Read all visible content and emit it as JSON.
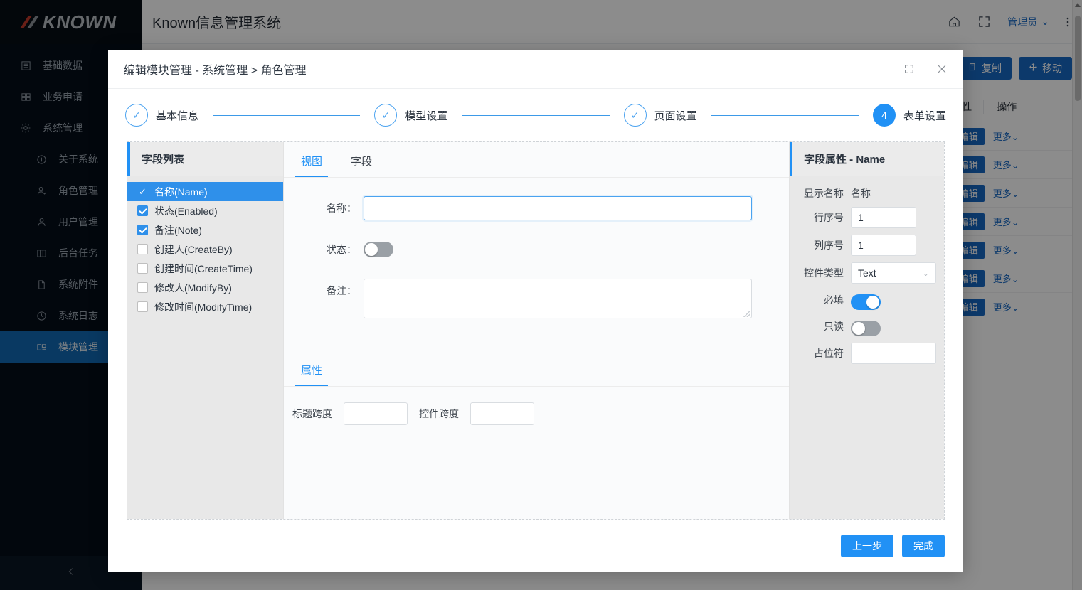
{
  "brand": {
    "logo_text": "KNOWN",
    "accent": "#c0392b"
  },
  "topbar": {
    "title": "Known信息管理系统",
    "home_icon": "home-icon",
    "fullscreen_icon": "fullscreen-icon",
    "user": "管理员",
    "user_caret": "⌄",
    "more_icon": "vertical-dots-icon"
  },
  "sidebar": {
    "items": [
      {
        "label": "基础数据",
        "icon": "list-icon",
        "level": 0,
        "active": false
      },
      {
        "label": "业务申请",
        "icon": "apps-icon",
        "level": 0,
        "active": false
      },
      {
        "label": "系统管理",
        "icon": "gear-icon",
        "level": 0,
        "active": false
      },
      {
        "label": "关于系统",
        "icon": "info-icon",
        "level": 1,
        "active": false
      },
      {
        "label": "角色管理",
        "icon": "role-icon",
        "level": 1,
        "active": false
      },
      {
        "label": "用户管理",
        "icon": "user-icon",
        "level": 1,
        "active": false
      },
      {
        "label": "后台任务",
        "icon": "task-icon",
        "level": 1,
        "active": false
      },
      {
        "label": "系统附件",
        "icon": "file-icon",
        "level": 1,
        "active": false
      },
      {
        "label": "系统日志",
        "icon": "clock-icon",
        "level": 1,
        "active": false
      },
      {
        "label": "模块管理",
        "icon": "module-icon",
        "level": 1,
        "active": true
      }
    ],
    "collapse_icon": "chevron-left-icon"
  },
  "background_page": {
    "toolbar": [
      {
        "label": "复制",
        "icon": "copy-icon"
      },
      {
        "label": "移动",
        "icon": "move-icon"
      }
    ],
    "columns": [
      "性",
      "操作"
    ],
    "rows": [
      {
        "edit": "编辑",
        "more": "更多"
      },
      {
        "edit": "编辑",
        "more": "更多"
      },
      {
        "edit": "编辑",
        "more": "更多"
      },
      {
        "edit": "编辑",
        "more": "更多"
      },
      {
        "edit": "编辑",
        "more": "更多"
      },
      {
        "edit": "编辑",
        "more": "更多"
      },
      {
        "edit": "编辑",
        "more": "更多"
      }
    ]
  },
  "modal": {
    "title": "编辑模块管理 - 系统管理 > 角色管理",
    "maximize_icon": "maximize-icon",
    "close_icon": "close-icon",
    "steps": [
      {
        "label": "基本信息",
        "state": "done",
        "marker": "✓"
      },
      {
        "label": "模型设置",
        "state": "done",
        "marker": "✓"
      },
      {
        "label": "页面设置",
        "state": "done",
        "marker": "✓"
      },
      {
        "label": "表单设置",
        "state": "current",
        "marker": "4"
      }
    ],
    "field_list": {
      "title": "字段列表",
      "items": [
        {
          "label": "名称(Name)",
          "checked": true,
          "selected": true
        },
        {
          "label": "状态(Enabled)",
          "checked": true,
          "selected": false
        },
        {
          "label": "备注(Note)",
          "checked": true,
          "selected": false
        },
        {
          "label": "创建人(CreateBy)",
          "checked": false,
          "selected": false
        },
        {
          "label": "创建时间(CreateTime)",
          "checked": false,
          "selected": false
        },
        {
          "label": "修改人(ModifyBy)",
          "checked": false,
          "selected": false
        },
        {
          "label": "修改时间(ModifyTime)",
          "checked": false,
          "selected": false
        }
      ]
    },
    "center": {
      "tabs": [
        {
          "label": "视图",
          "active": true
        },
        {
          "label": "字段",
          "active": false
        }
      ],
      "preview": {
        "name_label": "名称：",
        "name_value": "",
        "status_label": "状态：",
        "status_on": false,
        "note_label": "备注：",
        "note_value": ""
      },
      "attr_tab": "属性",
      "attrs": [
        {
          "label": "标题跨度",
          "value": ""
        },
        {
          "label": "控件跨度",
          "value": ""
        }
      ]
    },
    "props": {
      "title": "字段属性 - Name",
      "display_name_label": "显示名称",
      "display_name_value": "名称",
      "row_no_label": "行序号",
      "row_no_value": "1",
      "col_no_label": "列序号",
      "col_no_value": "1",
      "control_type_label": "控件类型",
      "control_type_value": "Text",
      "control_type_caret": "⌄",
      "required_label": "必填",
      "required_on": true,
      "readonly_label": "只读",
      "readonly_on": false,
      "placeholder_label": "占位符",
      "placeholder_value": ""
    },
    "footer": {
      "prev_label": "上一步",
      "finish_label": "完成"
    }
  },
  "colors": {
    "primary": "#2191f5",
    "sidebar_bg": "#040d18",
    "sidebar_active": "#1268b3"
  }
}
